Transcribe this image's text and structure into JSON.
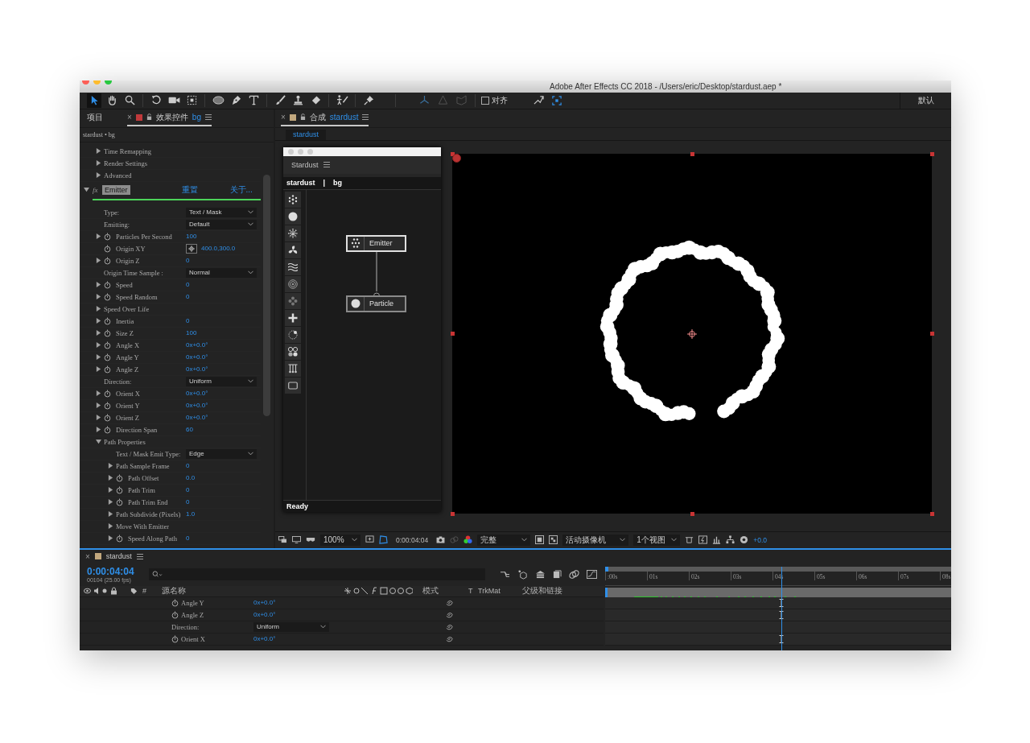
{
  "window": {
    "title": "Adobe After Effects CC 2018 - /Users/eric/Desktop/stardust.aep *"
  },
  "toolbar": {
    "snap": {
      "label": "对齐",
      "checked": false
    },
    "workspace": "默认"
  },
  "effects_panel": {
    "tabs": [
      {
        "label": "项目",
        "selected": false
      },
      {
        "label": "效果控件",
        "layer": "bg",
        "close": "×",
        "selected": true
      }
    ],
    "layer_path": "stardust • bg",
    "rows": [
      {
        "kind": "group",
        "label": "Time Remapping",
        "expanded": false
      },
      {
        "kind": "group",
        "label": "Render Settings",
        "expanded": false
      },
      {
        "kind": "group",
        "label": "Advanced",
        "expanded": false
      }
    ],
    "effect": {
      "badge": "fx",
      "name": "Emitter",
      "expanded": true,
      "reset": "重置",
      "about": "关于...",
      "properties": [
        {
          "kind": "dropdown",
          "label": "Type:",
          "value": "Text / Mask"
        },
        {
          "kind": "dropdown",
          "label": "Emitting:",
          "value": "Default"
        },
        {
          "kind": "value",
          "label": "Particles Per Second",
          "value": "100",
          "expanded": false,
          "animatable": true
        },
        {
          "kind": "point",
          "label": "Origin XY",
          "value": "400.0,300.0",
          "animatable": true
        },
        {
          "kind": "value",
          "label": "Origin Z",
          "value": "0",
          "expanded": false,
          "animatable": true
        },
        {
          "kind": "dropdown",
          "label": "Origin Time Sample :",
          "value": "Normal"
        },
        {
          "kind": "value",
          "label": "Speed",
          "value": "0",
          "expanded": false,
          "animatable": true
        },
        {
          "kind": "value",
          "label": "Speed Random",
          "value": "0",
          "expanded": false,
          "animatable": true
        },
        {
          "kind": "group",
          "label": "Speed Over Life",
          "expanded": false
        },
        {
          "kind": "value",
          "label": "Inertia",
          "value": "0",
          "expanded": false,
          "animatable": true
        },
        {
          "kind": "value",
          "label": "Size Z",
          "value": "100",
          "expanded": false,
          "animatable": true
        },
        {
          "kind": "value",
          "label": "Angle X",
          "value": "0x+0.0°",
          "expanded": false,
          "animatable": true
        },
        {
          "kind": "value",
          "label": "Angle Y",
          "value": "0x+0.0°",
          "expanded": false,
          "animatable": true
        },
        {
          "kind": "value",
          "label": "Angle Z",
          "value": "0x+0.0°",
          "expanded": false,
          "animatable": true
        },
        {
          "kind": "dropdown",
          "label": "Direction:",
          "value": "Uniform"
        },
        {
          "kind": "value",
          "label": "Orient X",
          "value": "0x+0.0°",
          "expanded": false,
          "animatable": true
        },
        {
          "kind": "value",
          "label": "Orient Y",
          "value": "0x+0.0°",
          "expanded": false,
          "animatable": true
        },
        {
          "kind": "value",
          "label": "Orient Z",
          "value": "0x+0.0°",
          "expanded": false,
          "animatable": true
        },
        {
          "kind": "value",
          "label": "Direction Span",
          "value": "60",
          "expanded": false,
          "animatable": true
        },
        {
          "kind": "group",
          "label": "Path Properties",
          "expanded": true,
          "children": [
            {
              "kind": "dropdown",
              "label": "Text / Mask Emit Type:",
              "value": "Edge"
            },
            {
              "kind": "value",
              "label": "Path Sample Frame",
              "value": "0",
              "expanded": false,
              "animatable": false
            },
            {
              "kind": "value",
              "label": "Path Offset",
              "value": "0.0",
              "expanded": false,
              "animatable": true
            },
            {
              "kind": "value",
              "label": "Path Trim",
              "value": "0",
              "expanded": false,
              "animatable": true
            },
            {
              "kind": "value",
              "label": "Path Trim End",
              "value": "0",
              "expanded": false,
              "animatable": true
            },
            {
              "kind": "value",
              "label": "Path Subdivide (Pixels)",
              "value": "1.0",
              "expanded": false,
              "animatable": false
            },
            {
              "kind": "group",
              "label": "Move With Emitter",
              "expanded": false
            },
            {
              "kind": "value",
              "label": "Speed Along Path",
              "value": "0",
              "expanded": false,
              "animatable": true
            }
          ]
        }
      ]
    }
  },
  "composition_panel": {
    "tab": {
      "close": "×",
      "label": "合成",
      "comp": "stardust"
    },
    "subtab": "stardust",
    "viewer": {
      "zoom": "100%",
      "time": "0:00:04:04",
      "resolution": "完整",
      "camera": "活动摄像机",
      "views": "1个视图",
      "exposure": "+0.0"
    }
  },
  "stardust_panel": {
    "title": "Stardust",
    "breadcrumb": [
      "stardust",
      "bg"
    ],
    "separator": "|",
    "nodes": [
      {
        "label": "Emitter",
        "kind": "emitter",
        "selected": true
      },
      {
        "label": "Particle",
        "kind": "particle",
        "selected": false
      }
    ],
    "status": "Ready"
  },
  "timeline": {
    "close": "×",
    "comp": "stardust",
    "time": "0:00:04:04",
    "frame_info": "00104 (25.00 fps)",
    "headers": {
      "number": "#",
      "source_name": "源名称",
      "mode": "模式",
      "t": "T",
      "trkmat": "TrkMat",
      "parent": "父级和链接"
    },
    "ruler": [
      ":00s",
      "01s",
      "02s",
      "03s",
      "04s",
      "05s",
      "06s",
      "07s",
      "08s"
    ],
    "playhead": {
      "level": 0.51
    },
    "rows": [
      {
        "kind": "value",
        "label": "Angle Y",
        "value": "0x+0.0°"
      },
      {
        "kind": "value",
        "label": "Angle Z",
        "value": "0x+0.0°"
      },
      {
        "kind": "dropdown",
        "label": "Direction:",
        "value": "Uniform"
      },
      {
        "kind": "value",
        "label": "Orient X",
        "value": "0x+0.0°"
      }
    ]
  }
}
